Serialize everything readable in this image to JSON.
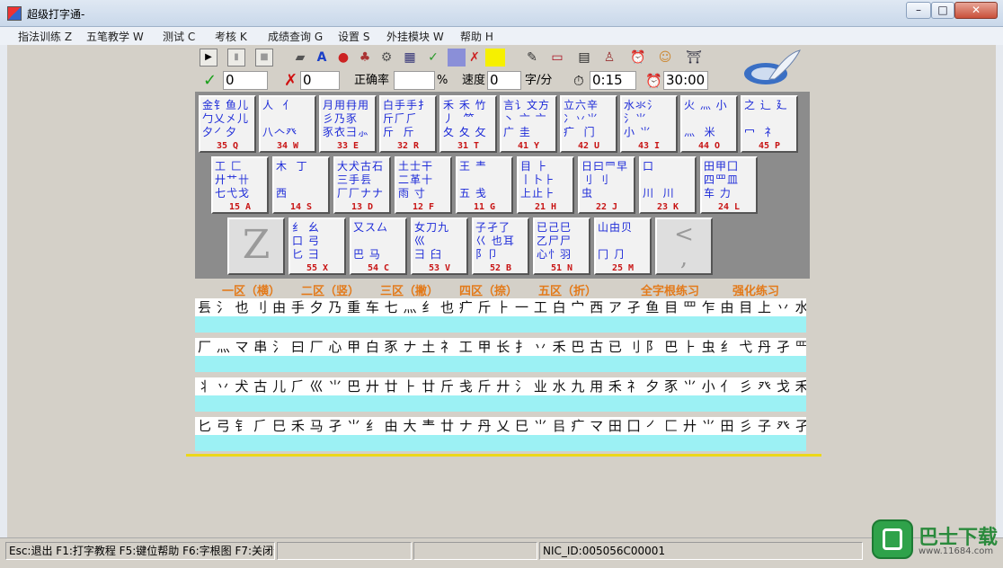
{
  "window": {
    "title": "超级打字通-",
    "min": "–",
    "max": "□",
    "close": "✕"
  },
  "menu": [
    "指法训练 Z",
    "五笔教学 W",
    "测试 C",
    "考核 K",
    "成绩查询 G",
    "设置 S",
    "外挂模块 W",
    "帮助 H"
  ],
  "toolbar": {
    "icons": [
      "play-icon",
      "pause-icon",
      "stop-icon",
      "book-icon",
      "font-icon",
      "record-icon",
      "users-icon",
      "settings-icon",
      "film-icon",
      "check-icon",
      "blank-icon",
      "cross-icon",
      "highlight-icon"
    ],
    "icons2": [
      "notes-icon",
      "monitor-icon",
      "document-icon",
      "person-icon",
      "alarm-icon",
      "user-icon",
      "exit-icon"
    ]
  },
  "stats": {
    "correct_mark": "✓",
    "correct_count": "0",
    "wrong_mark": "✗",
    "wrong_count": "0",
    "accuracy_label": "正确率",
    "accuracy_value": "",
    "percent_sign": "%",
    "speed_label": "速度",
    "speed_value": "0",
    "speed_unit": "字/分",
    "elapsed": "0:15",
    "limit": "30:00"
  },
  "keyboard": {
    "row1": [
      {
        "roots": "金钅鱼儿\n勹乂㐅儿\n夕㇒夕",
        "code": "35 Q"
      },
      {
        "roots": "人  亻\n\n八𠆢癶",
        "code": "34 W"
      },
      {
        "roots": "月用冄用\n彡乃豕\n豕衣⺕⺗",
        "code": "33 E"
      },
      {
        "roots": "白手手扌\n斤𠂆⺁\n斤  斤",
        "code": "32 R"
      },
      {
        "roots": "禾 禾 竹\n丿  ⺮\n夂 夂 攵",
        "code": "31 T"
      },
      {
        "roots": "言讠文方\n丶 亠 亠\n广 圭",
        "code": "41 Y"
      },
      {
        "roots": "立六辛\n冫丷⺌\n疒  门",
        "code": "42 U"
      },
      {
        "roots": "水氺⺡\n氵⺌\n小 ⺌",
        "code": "43 I"
      },
      {
        "roots": "火 灬 小\n\n灬  米",
        "code": "44 O"
      },
      {
        "roots": "之 辶 廴\n\n冖  礻",
        "code": "45 P"
      }
    ],
    "row2": [
      {
        "roots": "工 匚\n廾艹卄\n七弋戈",
        "code": "15 A"
      },
      {
        "roots": "木  丁\n\n西",
        "code": "14 S"
      },
      {
        "roots": "大犬古石\n三手镸\n厂厂ナナ",
        "code": "13 D"
      },
      {
        "roots": "土士干\n二革十\n雨 寸",
        "code": "12 F"
      },
      {
        "roots": "王 龶\n\n五 戋",
        "code": "11 G"
      },
      {
        "roots": "目 ⺊\n丨卜⺊\n上止⺊",
        "code": "21 H"
      },
      {
        "roots": "日曰⺜早\n刂 刂\n虫",
        "code": "22 J"
      },
      {
        "roots": "口\n\n川  川",
        "code": "23 K"
      },
      {
        "roots": "田甲囗\n四罒皿\n车 力",
        "code": "24 L"
      }
    ],
    "row3": [
      {
        "big": "Z"
      },
      {
        "roots": "纟 幺\n口 弓\n匕 ⺕",
        "code": "55 X"
      },
      {
        "roots": "又ス厶\n\n巴 马",
        "code": "54 C"
      },
      {
        "roots": "女刀九\n巛\n彐 臼",
        "code": "53 V"
      },
      {
        "roots": "子孑了\n巜 也耳\n阝卩",
        "code": "52 B"
      },
      {
        "roots": "已己巳\n乙尸尸\n心忄羽",
        "code": "51 N"
      },
      {
        "roots": "山由贝\n\n冂 ⺆",
        "code": "25 M"
      },
      {
        "big": "<\n,"
      }
    ]
  },
  "zones": [
    "一区（横）",
    "二区（竖）",
    "三区（撇）",
    "四区（捺）",
    "五区（折）",
    "全字根练习",
    "强化练习"
  ],
  "practice": [
    "镸 氵 也 刂 由 手 夕 乃 重 车 七 灬 纟 也 疒 斤 ⺊ 一 工 白 宀 西 ア 孑 鱼 目 罒 乍 由 目 上 丷 水",
    "厂 灬 マ 串 氵 曰 厂 心 甲 白 豕 ナ 土 礻 工 甲 长 扌 丷 禾 巴 古 已 刂 阝 巴 ⺊ 虫 纟 弋 丹 孑 罒 目",
    "丬 丷 犬 古 儿 ⺁ 巛 ⺌ 巴 廾 廿 ⺊ 廿 斤 戋 斤 廾 氵 业 水 九 用 禾 礻 夕 豕 ⺌ 小 亻 彡 癶 戈 禾 止",
    "匕 弓 钅 ⺁ 巳 禾 马 孑 ⺌ 纟 由 大 龶 廿 ナ 丹 乂 巳 ⺌ 㠯 疒 マ 田 囗 ㇒ 匚 廾 ⺌ 田 彡 子 癶 孑"
  ],
  "status": {
    "help": "Esc:退出   F1:打字教程   F5:键位帮助   F6:字根图   F7:关闭帮助",
    "empty1": "",
    "nic": "NIC_ID:005056C00001",
    "empty2": ""
  },
  "watermark": {
    "text": "巴士下载",
    "url": "www.11684.com"
  }
}
